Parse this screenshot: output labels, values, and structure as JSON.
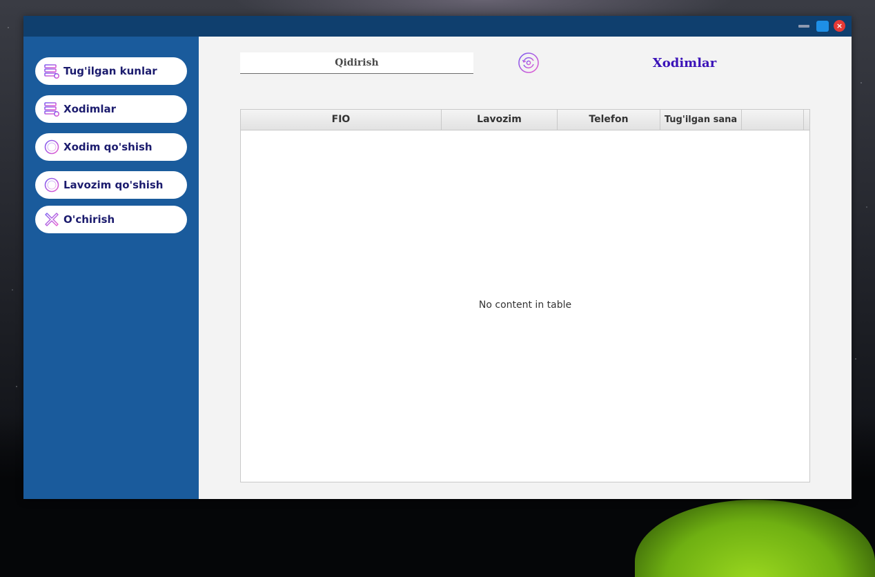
{
  "window": {
    "controls": [
      "minimize",
      "maximize",
      "close"
    ],
    "close_glyph": "×"
  },
  "sidebar": {
    "items": [
      {
        "label": "Tug'ilgan kunlar",
        "icon": "database-icon"
      },
      {
        "label": "Xodimlar",
        "icon": "database-icon"
      },
      {
        "label": "Xodim qo'shish",
        "icon": "plus-circle-icon"
      },
      {
        "label": "Lavozim qo'shish",
        "icon": "plus-circle-icon"
      },
      {
        "label": "O'chirish",
        "icon": "delete-x-icon"
      }
    ]
  },
  "header": {
    "search_placeholder": "Qidirish",
    "title": "Xodimlar",
    "refresh_icon": "refresh-icon"
  },
  "table": {
    "columns": [
      "FIO",
      "Lavozim",
      "Telefon",
      "Tug'ilgan sana",
      ""
    ],
    "rows": [],
    "empty_message": "No content in table"
  },
  "colors": {
    "titlebar": "#0f3f6e",
    "sidebar": "#1a5b9c",
    "nav_text": "#1c1c6e",
    "title_text": "#3a12b8",
    "content_bg": "#f3f3f3",
    "icon_gradient_start": "#7b5cf0",
    "icon_gradient_end": "#e85fd0"
  }
}
